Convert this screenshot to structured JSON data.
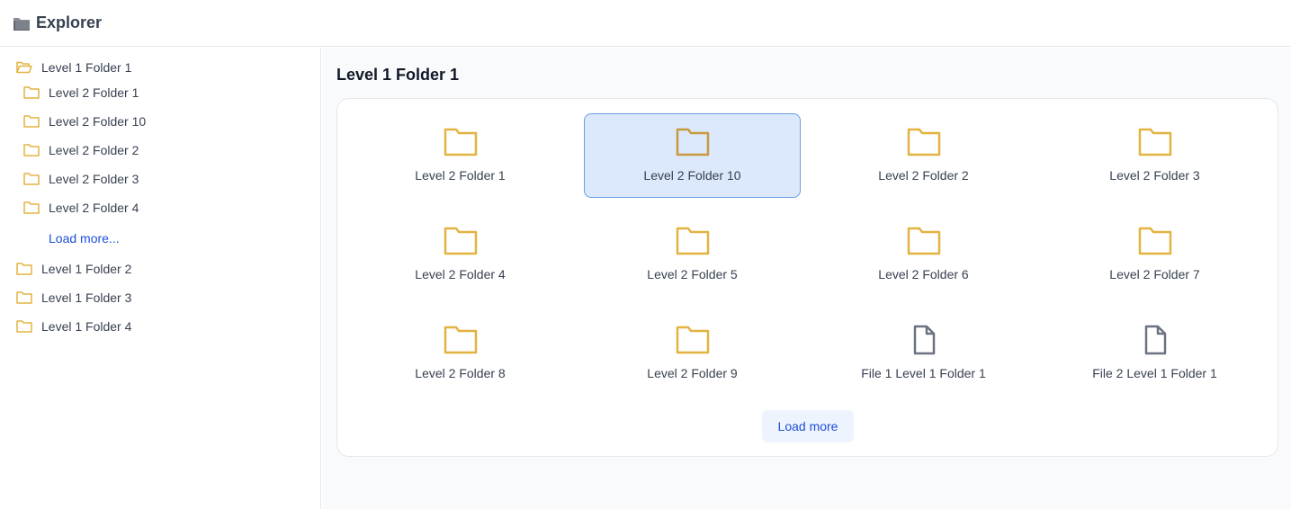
{
  "app": {
    "title": "Explorer"
  },
  "sidebar": {
    "items": [
      {
        "label": "Level 1 Folder 1",
        "level": 1,
        "open": true
      },
      {
        "label": "Level 2 Folder 1",
        "level": 2
      },
      {
        "label": "Level 2 Folder 10",
        "level": 2
      },
      {
        "label": "Level 2 Folder 2",
        "level": 2
      },
      {
        "label": "Level 2 Folder 3",
        "level": 2
      },
      {
        "label": "Level 2 Folder 4",
        "level": 2
      },
      {
        "label": "Level 1 Folder 2",
        "level": 1
      },
      {
        "label": "Level 1 Folder 3",
        "level": 1
      },
      {
        "label": "Level 1 Folder 4",
        "level": 1
      }
    ],
    "load_more_label": "Load more..."
  },
  "main": {
    "title": "Level 1 Folder 1",
    "tiles": [
      {
        "label": "Level 2 Folder 1",
        "type": "folder"
      },
      {
        "label": "Level 2 Folder 10",
        "type": "folder",
        "selected": true
      },
      {
        "label": "Level 2 Folder 2",
        "type": "folder"
      },
      {
        "label": "Level 2 Folder 3",
        "type": "folder"
      },
      {
        "label": "Level 2 Folder 4",
        "type": "folder"
      },
      {
        "label": "Level 2 Folder 5",
        "type": "folder"
      },
      {
        "label": "Level 2 Folder 6",
        "type": "folder"
      },
      {
        "label": "Level 2 Folder 7",
        "type": "folder"
      },
      {
        "label": "Level 2 Folder 8",
        "type": "folder"
      },
      {
        "label": "Level 2 Folder 9",
        "type": "folder"
      },
      {
        "label": "File 1 Level 1 Folder 1",
        "type": "file"
      },
      {
        "label": "File 2 Level 1 Folder 1",
        "type": "file"
      }
    ],
    "load_more_label": "Load more"
  },
  "colors": {
    "folder": "#e3b341",
    "folder_selected": "#c89a3c",
    "file": "#6b7280",
    "accent": "#1d4ed8",
    "selected_bg": "#dce8fb"
  }
}
